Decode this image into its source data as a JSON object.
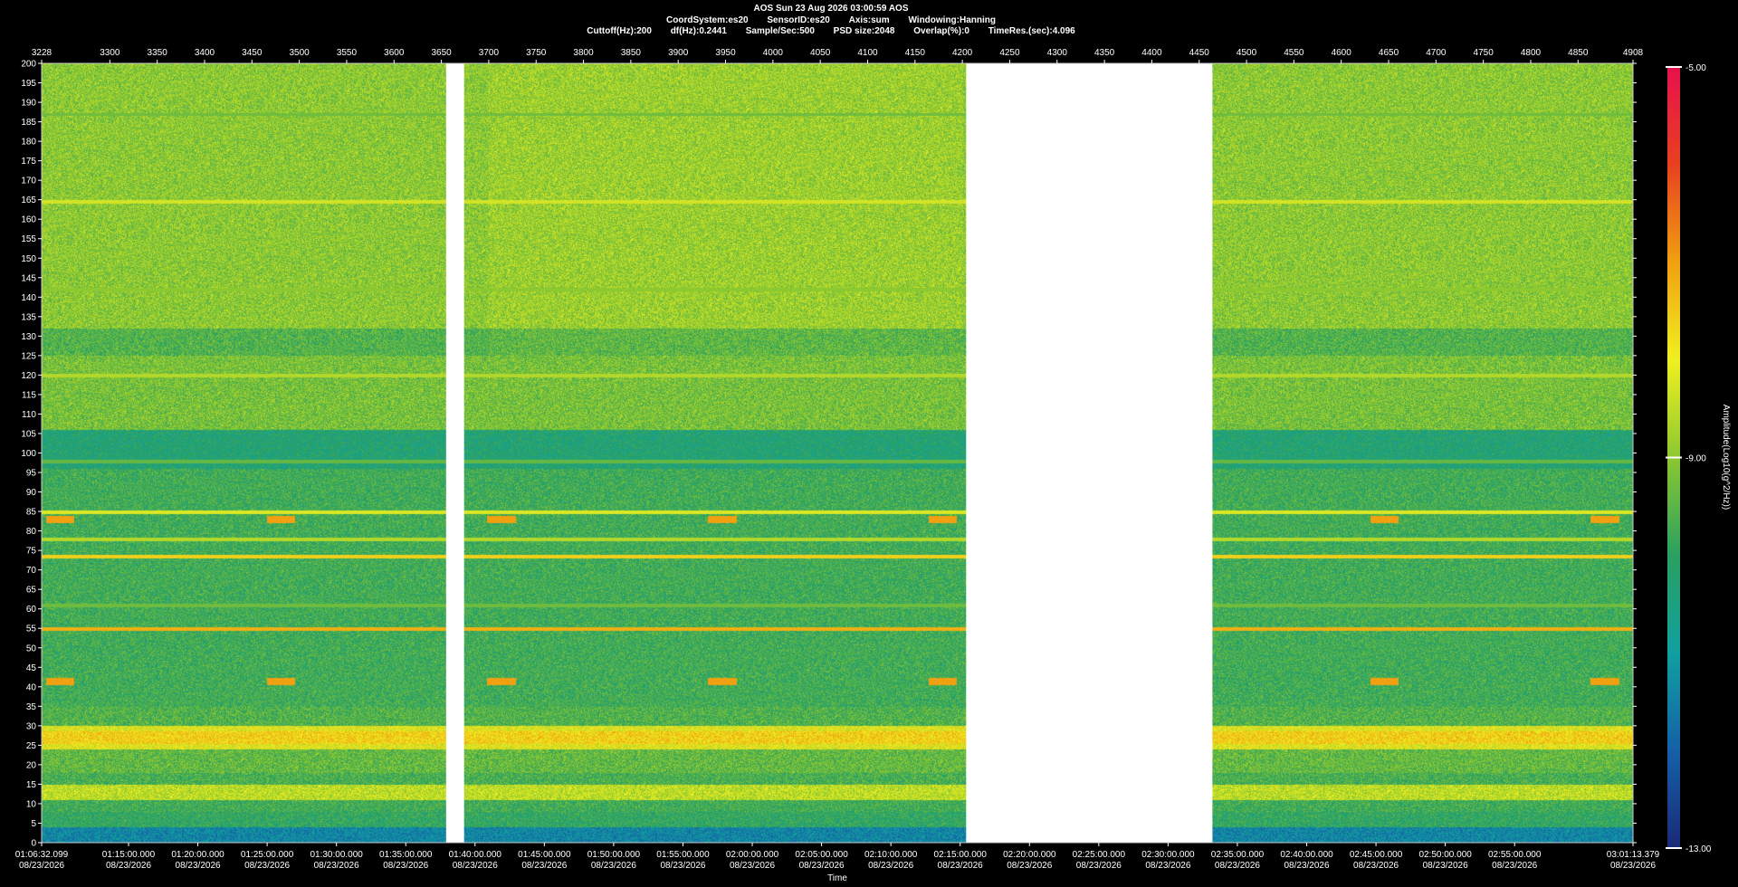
{
  "header": {
    "line1": "AOS  Sun 23 Aug 2026 03:00:59  AOS",
    "line2": [
      "CoordSystem:es20",
      "SensorID:es20",
      "Axis:sum",
      "Windowing:Hanning"
    ],
    "line3": [
      "Cuttoff(Hz):200",
      "df(Hz):0.2441",
      "Sample/Sec:500",
      "PSD size:2048",
      "Overlap(%):0",
      "TimeRes.(sec):4.096"
    ]
  },
  "chart_data": {
    "type": "heatmap",
    "title": "AOS  Sun 23 Aug 2026 03:00:59  AOS",
    "xlabel": "Time",
    "colorbar_label": "Amplitude(Log10(g^2/Hz))",
    "colorbar_ticks": [
      "-5.00",
      "-9.00",
      "-13.00"
    ],
    "clim": [
      -13,
      -5
    ],
    "xlim_top": [
      3228,
      4908
    ],
    "top_ticks": [
      "3228",
      "3300",
      "3350",
      "3400",
      "3450",
      "3500",
      "3550",
      "3600",
      "3650",
      "3700",
      "3750",
      "3800",
      "3850",
      "3900",
      "3950",
      "4000",
      "4050",
      "4100",
      "4150",
      "4200",
      "4250",
      "4300",
      "4350",
      "4400",
      "4450",
      "4500",
      "4550",
      "4600",
      "4650",
      "4700",
      "4750",
      "4800",
      "4850",
      "4908"
    ],
    "ylim": [
      0,
      200
    ],
    "y_ticks": [
      200,
      195,
      190,
      185,
      180,
      175,
      170,
      165,
      160,
      155,
      150,
      145,
      140,
      135,
      130,
      125,
      120,
      115,
      110,
      105,
      100,
      95,
      90,
      85,
      80,
      75,
      70,
      65,
      60,
      55,
      50,
      45,
      40,
      35,
      30,
      25,
      20,
      15,
      10,
      5,
      0
    ],
    "bottom_ticks": [
      {
        "t": "01:06:32.099",
        "d": "08/23/2026"
      },
      {
        "t": "01:15:00.000",
        "d": "08/23/2026"
      },
      {
        "t": "01:20:00.000",
        "d": "08/23/2026"
      },
      {
        "t": "01:25:00.000",
        "d": "08/23/2026"
      },
      {
        "t": "01:30:00.000",
        "d": "08/23/2026"
      },
      {
        "t": "01:35:00.000",
        "d": "08/23/2026"
      },
      {
        "t": "01:40:00.000",
        "d": "08/23/2026"
      },
      {
        "t": "01:45:00.000",
        "d": "08/23/2026"
      },
      {
        "t": "01:50:00.000",
        "d": "08/23/2026"
      },
      {
        "t": "01:55:00.000",
        "d": "08/23/2026"
      },
      {
        "t": "02:00:00.000",
        "d": "08/23/2026"
      },
      {
        "t": "02:05:00.000",
        "d": "08/23/2026"
      },
      {
        "t": "02:10:00.000",
        "d": "08/23/2026"
      },
      {
        "t": "02:15:00.000",
        "d": "08/23/2026"
      },
      {
        "t": "02:20:00.000",
        "d": "08/23/2026"
      },
      {
        "t": "02:25:00.000",
        "d": "08/23/2026"
      },
      {
        "t": "02:30:00.000",
        "d": "08/23/2026"
      },
      {
        "t": "02:35:00.000",
        "d": "08/23/2026"
      },
      {
        "t": "02:40:00.000",
        "d": "08/23/2026"
      },
      {
        "t": "02:45:00.000",
        "d": "08/23/2026"
      },
      {
        "t": "02:50:00.000",
        "d": "08/23/2026"
      },
      {
        "t": "02:55:00.000",
        "d": "08/23/2026"
      },
      {
        "t": "03:01:13.379",
        "d": "08/23/2026"
      }
    ],
    "data_gaps_x": [
      [
        3655,
        3674
      ],
      [
        4204,
        4464
      ]
    ],
    "persistent_bands_hz": [
      {
        "hz": 85,
        "level": -8.2
      },
      {
        "hz": 78,
        "level": -8.6
      },
      {
        "hz": 73.5,
        "level": -7.6
      },
      {
        "hz": 55,
        "level": -7.2
      },
      {
        "hz": 61,
        "level": -9.3
      },
      {
        "hz": 120,
        "level": -8.6
      },
      {
        "hz": 164.5,
        "level": -8.3
      },
      {
        "hz": 142,
        "level": -9.0
      },
      {
        "hz": 187,
        "level": -9.3
      },
      {
        "hz": 98,
        "level": -9.4
      }
    ],
    "intermittent_tones_hz": [
      83,
      41.5
    ],
    "colormap": [
      "#1a2a78",
      "#1560a8",
      "#10a0a0",
      "#2aa060",
      "#8cc830",
      "#f0f020",
      "#f0a010",
      "#e84020",
      "#e8104c"
    ]
  }
}
